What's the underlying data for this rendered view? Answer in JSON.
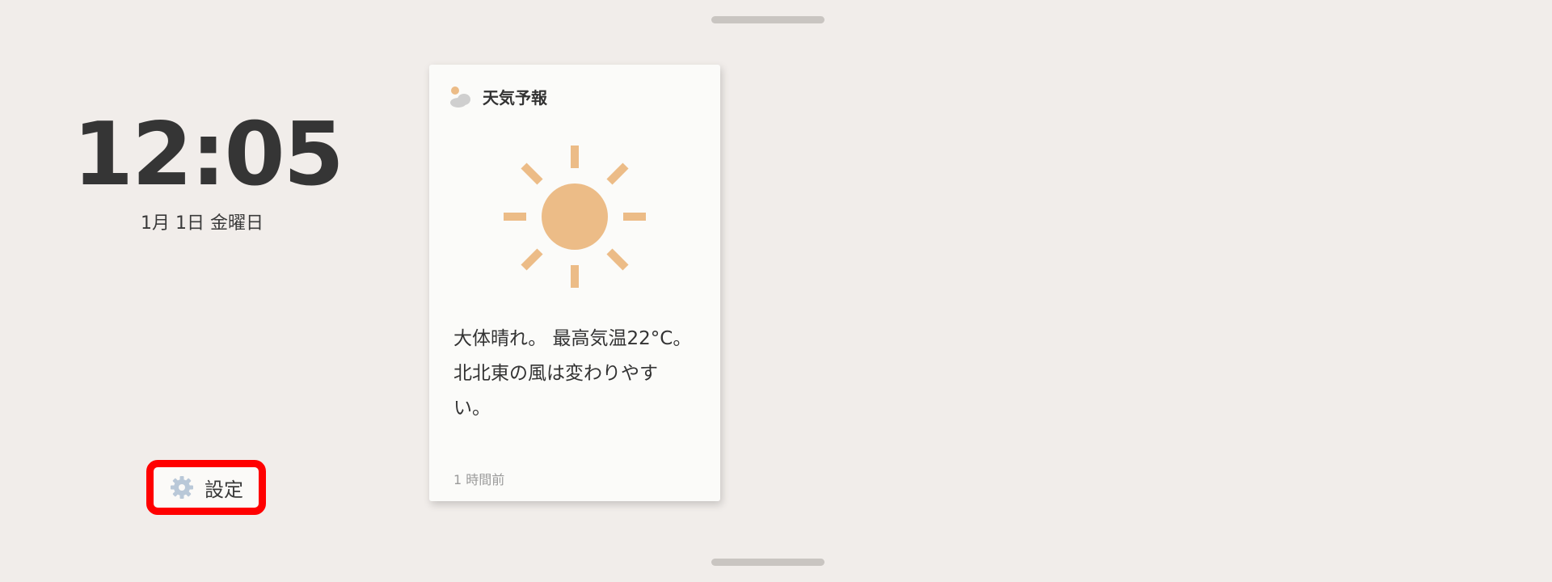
{
  "clock": {
    "time": "12:05",
    "date": "1月 1日 金曜日"
  },
  "settings": {
    "label": "設定",
    "icon": "gear-icon"
  },
  "weather_card": {
    "title": "天気予報",
    "header_icon": "partly-cloudy-icon",
    "condition_icon": "sun-icon",
    "description_lines": [
      "大体晴れ。 最高気温22°C。",
      "北北東の風は変わりやす",
      "い。"
    ],
    "updated": "1 時間前"
  },
  "colors": {
    "background": "#f1edea",
    "sun": "#ecbc87",
    "highlight_border": "#ff0000",
    "gear": "#b9c8d8"
  }
}
